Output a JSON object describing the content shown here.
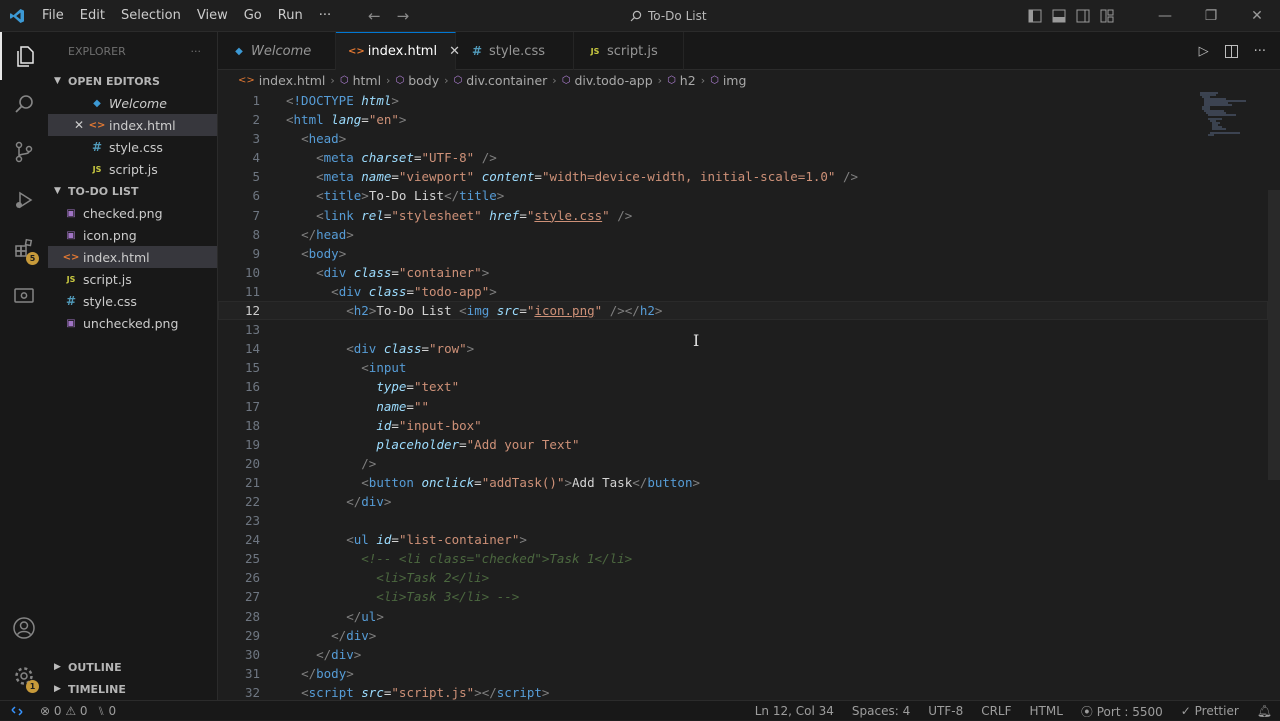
{
  "window": {
    "title": "To-Do List"
  },
  "menu": [
    "File",
    "Edit",
    "Selection",
    "View",
    "Go",
    "Run",
    "···"
  ],
  "explorer": {
    "header": "EXPLORER",
    "open_editors_label": "OPEN EDITORS",
    "open_editors": [
      {
        "name": "Welcome",
        "icon": "vscode-icon"
      },
      {
        "name": "index.html",
        "icon": "html-icon",
        "close": "✕"
      },
      {
        "name": "style.css",
        "icon": "css-icon"
      },
      {
        "name": "script.js",
        "icon": "js-icon"
      }
    ],
    "folder_label": "TO-DO LIST",
    "files": [
      {
        "name": "checked.png",
        "icon": "image-icon"
      },
      {
        "name": "icon.png",
        "icon": "image-icon"
      },
      {
        "name": "index.html",
        "icon": "html-icon"
      },
      {
        "name": "script.js",
        "icon": "js-icon"
      },
      {
        "name": "style.css",
        "icon": "css-icon"
      },
      {
        "name": "unchecked.png",
        "icon": "image-icon"
      }
    ],
    "outline_label": "OUTLINE",
    "timeline_label": "TIMELINE"
  },
  "activity_badges": {
    "extensions": "5",
    "settings": "1"
  },
  "tabs": [
    {
      "label": "Welcome",
      "icon": "vscode-icon"
    },
    {
      "label": "index.html",
      "icon": "html-icon",
      "close": "✕"
    },
    {
      "label": "style.css",
      "icon": "css-icon"
    },
    {
      "label": "script.js",
      "icon": "js-icon"
    }
  ],
  "breadcrumb": [
    "index.html",
    "html",
    "body",
    "div.container",
    "div.todo-app",
    "h2",
    "img"
  ],
  "editor": {
    "line_numbers": [
      "1",
      "2",
      "3",
      "4",
      "5",
      "6",
      "7",
      "8",
      "9",
      "10",
      "11",
      "12",
      "13",
      "14",
      "15",
      "16",
      "17",
      "18",
      "19",
      "20",
      "21",
      "22",
      "23",
      "24",
      "25",
      "26",
      "27",
      "28",
      "29",
      "30",
      "31",
      "32"
    ],
    "current_line": "12"
  },
  "statusbar": {
    "errors": "⊗ 0 ⚠ 0",
    "ports": "⑊ 0",
    "position": "Ln 12, Col 34",
    "spaces": "Spaces: 4",
    "encoding": "UTF-8",
    "eol": "CRLF",
    "language": "HTML",
    "port": "Port : 5500",
    "formatter": "Prettier"
  },
  "colors": {
    "accent": "#0078d4",
    "tag": "#569cd6",
    "attr": "#9cdcfe",
    "string": "#ce9178",
    "comment": "#6a9955"
  }
}
